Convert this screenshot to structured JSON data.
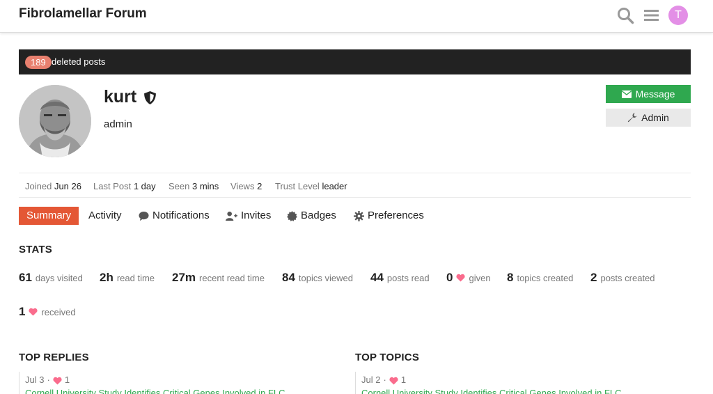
{
  "header": {
    "title": "Fibrolamellar Forum",
    "avatar_letter": "T",
    "avatar_color": "#e38fe6"
  },
  "deleted": {
    "count": "189",
    "label": "deleted posts"
  },
  "profile": {
    "username": "kurt",
    "title": "admin"
  },
  "buttons": {
    "message": "Message",
    "admin": "Admin"
  },
  "details": [
    {
      "label": "Joined",
      "value": "Jun 26"
    },
    {
      "label": "Last Post",
      "value": "1 day"
    },
    {
      "label": "Seen",
      "value": "3 mins"
    },
    {
      "label": "Views",
      "value": "2"
    },
    {
      "label": "Trust Level",
      "value": "leader"
    }
  ],
  "nav": [
    {
      "label": "Summary",
      "icon": ""
    },
    {
      "label": "Activity",
      "icon": ""
    },
    {
      "label": "Notifications",
      "icon": "comment-icon"
    },
    {
      "label": "Invites",
      "icon": "user-plus-icon"
    },
    {
      "label": "Badges",
      "icon": "certificate-icon"
    },
    {
      "label": "Preferences",
      "icon": "gear-icon"
    }
  ],
  "stats_title": "STATS",
  "stats": [
    {
      "num": "61",
      "label": "days visited"
    },
    {
      "num": "2h",
      "label": "read time"
    },
    {
      "num": "27m",
      "label": "recent read time"
    },
    {
      "num": "84",
      "label": "topics viewed"
    },
    {
      "num": "44",
      "label": "posts read"
    },
    {
      "num": "0",
      "label": "given",
      "heart": true
    },
    {
      "num": "8",
      "label": "topics created"
    },
    {
      "num": "2",
      "label": "posts created"
    },
    {
      "num": "1",
      "label": "received",
      "heart": true
    }
  ],
  "top_replies": {
    "title": "TOP REPLIES",
    "date": "Jul 3",
    "likes": "1",
    "link": "Cornell University Study Identifies Critical Genes Involved in FLC"
  },
  "top_topics": {
    "title": "TOP TOPICS",
    "date": "Jul 2",
    "likes": "1",
    "link": "Cornell University Study Identifies Critical Genes Involved in FLC"
  },
  "colors": {
    "accent": "#e45735",
    "success": "#2fa84f",
    "heart": "#fa6c8d",
    "dark_bar": "#222222"
  }
}
